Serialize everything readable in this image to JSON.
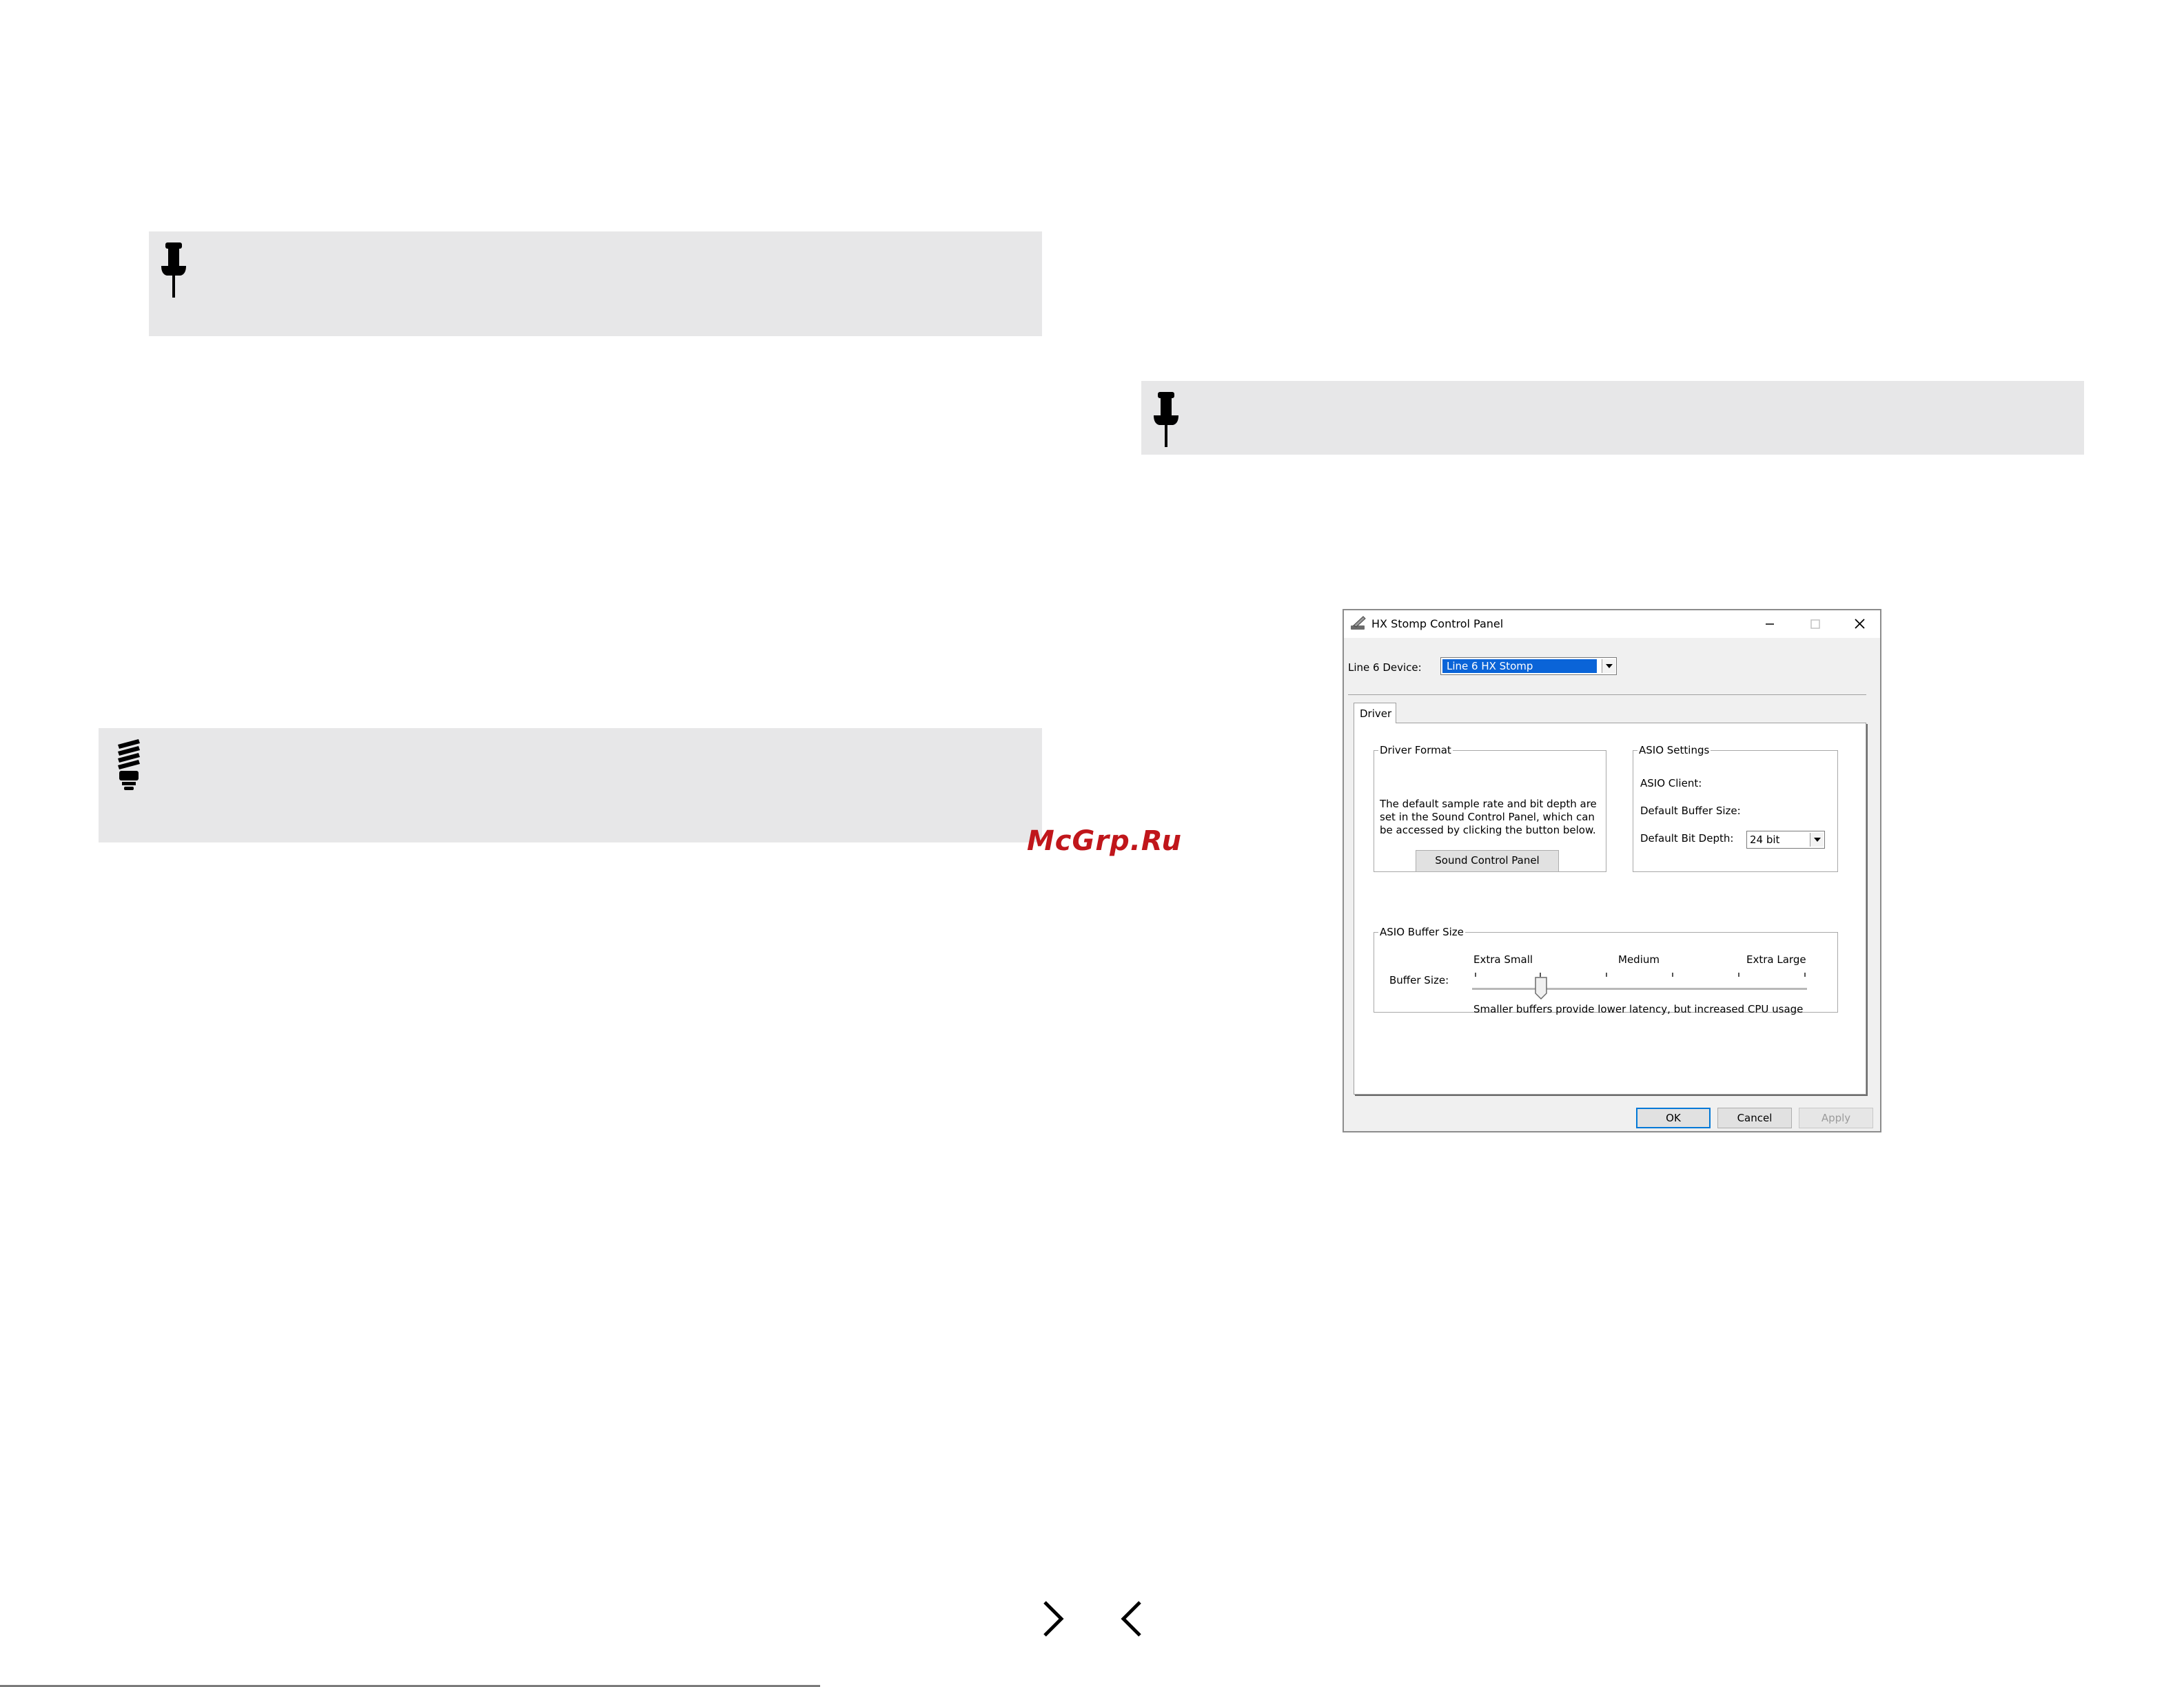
{
  "dialog": {
    "title": "HX Stomp Control Panel",
    "device_label": "Line 6 Device:",
    "device_value": "Line 6 HX Stomp",
    "tab_label": "Driver",
    "driver_format": {
      "legend": "Driver Format",
      "text": "The default sample rate and bit depth are set in the Sound Control Panel, which can be accessed by clicking the button below.",
      "button": "Sound Control Panel"
    },
    "asio_settings": {
      "legend": "ASIO Settings",
      "client_label": "ASIO Client:",
      "buffer_label": "Default Buffer Size:",
      "bitdepth_label": "Default Bit Depth:",
      "bitdepth_value": "24 bit"
    },
    "asio_buffer": {
      "legend": "ASIO Buffer Size",
      "buffer_label": "Buffer Size:",
      "tick_small": "Extra Small",
      "tick_medium": "Medium",
      "tick_large": "Extra Large",
      "hint": "Smaller buffers provide lower latency, but increased CPU usage",
      "slider_level_percent": 10
    },
    "buttons": {
      "ok": "OK",
      "cancel": "Cancel",
      "apply": "Apply"
    }
  },
  "watermark": "McGrp.Ru",
  "icons": {
    "note": "pushpin-icon",
    "tip": "lightbulb-icon",
    "next": "chevron-right-icon",
    "prev": "chevron-left-icon"
  }
}
